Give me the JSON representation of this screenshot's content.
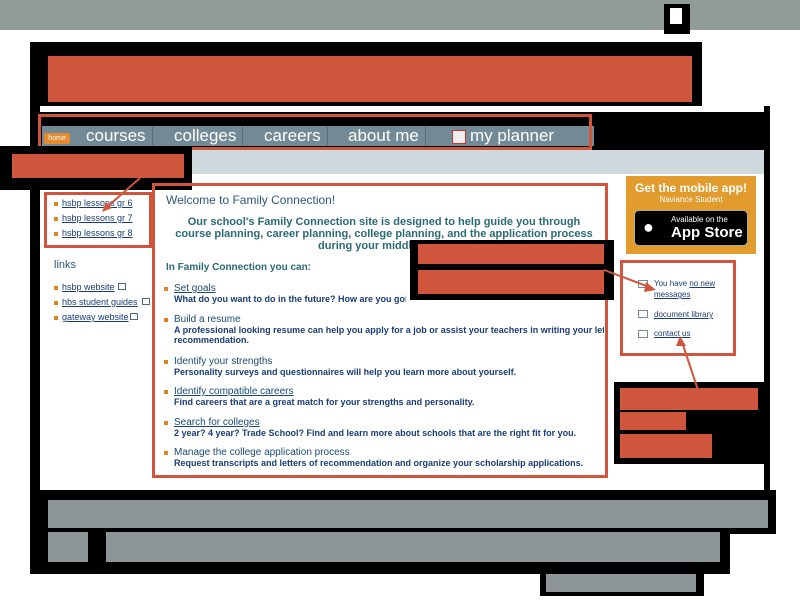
{
  "nav": {
    "home": "home",
    "items": [
      "courses",
      "colleges",
      "careers",
      "about me",
      "my planner"
    ]
  },
  "sidebar": {
    "quick_links": [
      "hsbp lessons gr 6",
      "hsbp lessons gr 7",
      "hsbp lessons gr 8"
    ],
    "links_heading": "links",
    "links": [
      "hsbp website",
      "hbs student guides",
      "gateway website"
    ]
  },
  "main": {
    "welcome": "Welcome to Family Connection!",
    "intro": "Our school's Family Connection site is designed to help guide you through course planning, career planning, college planning, and the application process during your middle and h",
    "in_fc": "In Family Connection you can:",
    "features": [
      {
        "title": "Set goals",
        "desc": "What do you want to do in the future? How are you going to",
        "link": true
      },
      {
        "title": "Build a resume",
        "desc": "A professional looking resume can help you apply for a job or assist your teachers in writing your letters of",
        "desc2": "recommendation.",
        "link": false
      },
      {
        "title": "Identify your strengths",
        "desc": "Personality surveys and questionnaires will help you learn more about yourself.",
        "link": false
      },
      {
        "title": "Identify compatible careers",
        "desc": "Find careers that are a great match for your strengths and personality.",
        "link": true
      },
      {
        "title": "Search for colleges",
        "desc": "2 year? 4 year? Trade School? Find and learn more about schools that are the right fit for you.",
        "link": true
      },
      {
        "title": "Manage the college application process",
        "desc": "Request transcripts and letters of recommendation and organize your scholarship applications.",
        "link": false
      }
    ]
  },
  "app_banner": {
    "title": "Get the mobile app!",
    "subtitle": "Naviance Student",
    "store_small": "Available on the",
    "store_big": "App Store"
  },
  "right_panel": {
    "messages_prefix": "You have",
    "messages_link": "no new",
    "messages_link2": "messages",
    "document_library": "document library",
    "contact_us": "contact us"
  },
  "colors": {
    "accent_red": "#d0553d",
    "nav_bg": "#718a96",
    "gray_bar": "#919c97",
    "app_orange": "#e29b2d"
  }
}
